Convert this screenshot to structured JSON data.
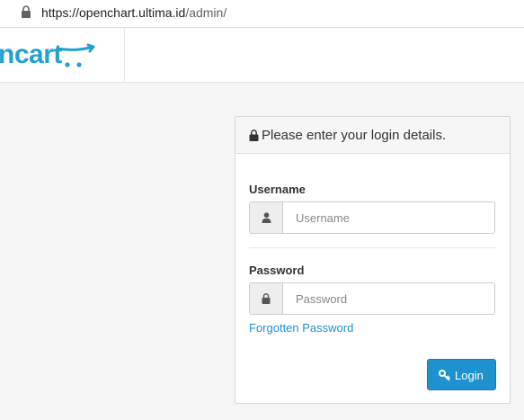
{
  "browser": {
    "url_host": "https://openchart.ultima.id",
    "url_path": "/admin/",
    "lock_icon": "lock-icon"
  },
  "header": {
    "logo_text": "ncart",
    "logo_icon": "cart-icon",
    "brand_color": "#23a1d1"
  },
  "login": {
    "title": "Please enter your login details.",
    "title_icon": "lock-icon",
    "username": {
      "label": "Username",
      "placeholder": "Username",
      "value": "",
      "icon": "user-icon"
    },
    "password": {
      "label": "Password",
      "placeholder": "Password",
      "value": "",
      "icon": "lock-icon"
    },
    "forgot_link": "Forgotten Password",
    "login_button": "Login",
    "login_button_icon": "key-icon",
    "accent_color": "#1e91cf"
  }
}
